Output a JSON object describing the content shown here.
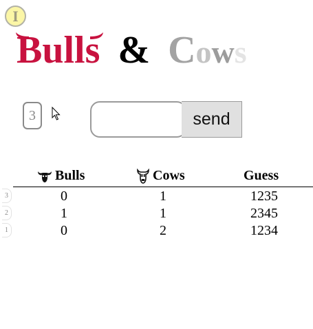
{
  "info_badge": "I",
  "title": {
    "bulls": "Bulls",
    "amp": "&",
    "cows_letters": [
      "C",
      "o",
      "w",
      "s"
    ]
  },
  "colors": {
    "bulls": "#c8123f",
    "amp": "#000000",
    "cows_c": "#a3a3a3",
    "cows_o": "#c4c4c4",
    "cows_w": "#9c9c9c",
    "cows_s": "#e4e4e4",
    "badge": "#fbf6a6"
  },
  "attempt_counter": "3",
  "guess_input": {
    "value": "",
    "placeholder": ""
  },
  "send_button": {
    "label": "send"
  },
  "table": {
    "headers": {
      "bulls": "Bulls",
      "cows": "Cows",
      "guess": "Guess"
    },
    "header_icons": {
      "bulls": "bull-head-icon",
      "cows": "cow-head-icon"
    },
    "rows": [
      {
        "no": "3",
        "bulls": "0",
        "cows": "1",
        "guess": "1235"
      },
      {
        "no": "2",
        "bulls": "1",
        "cows": "1",
        "guess": "2345"
      },
      {
        "no": "1",
        "bulls": "0",
        "cows": "2",
        "guess": "1234"
      }
    ]
  },
  "icons": {
    "cursor": "mouse-pointer-icon",
    "horns": "horn-icon"
  }
}
